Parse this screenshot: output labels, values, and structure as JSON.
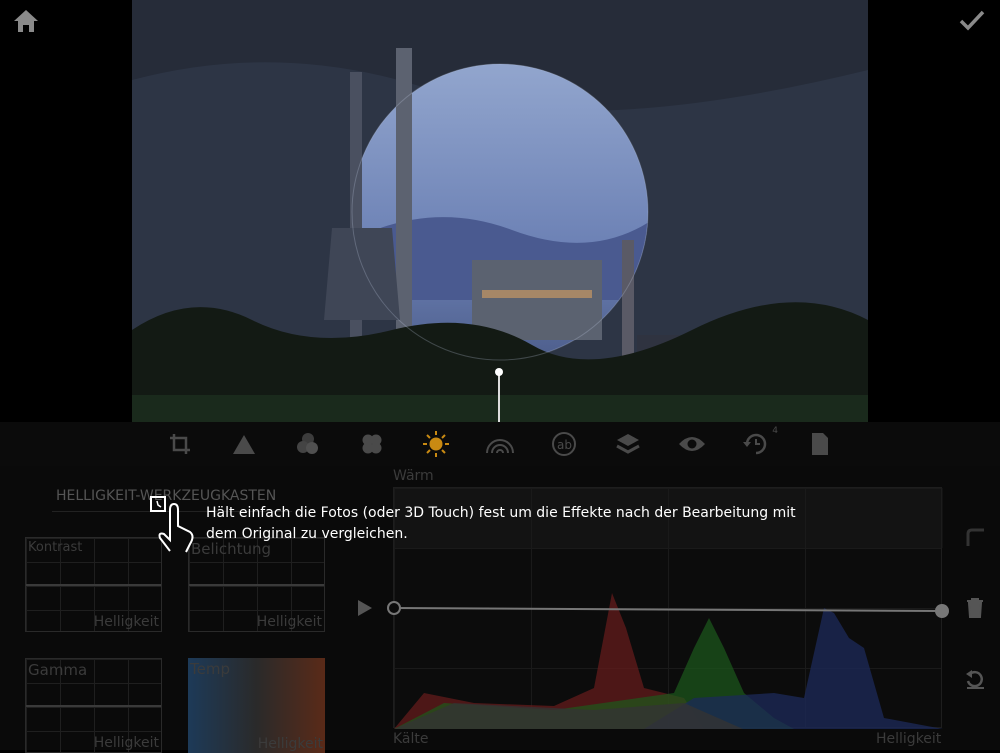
{
  "top": {
    "home_icon": "home-icon",
    "done_icon": "checkmark-icon"
  },
  "toolbar": {
    "items": [
      "crop-icon",
      "triangle-icon",
      "color-circles-icon",
      "clover-icon",
      "brightness-sun-icon",
      "rainbow-icon",
      "ab-icon",
      "layers-icon",
      "eye-icon",
      "history-icon",
      "document-icon"
    ],
    "history_count": "4",
    "active_color": "#c98a12"
  },
  "panel": {
    "title": "HELLIGKEIT-WERKZEUGKASTEN",
    "tiles": [
      {
        "label": "Kontrast",
        "sub": "Helligkeit"
      },
      {
        "label": "Belichtung",
        "sub": "Helligkeit"
      },
      {
        "label": "Gamma",
        "sub": "Helligkeit"
      },
      {
        "label": "Temp",
        "sub": "Helligkeit"
      }
    ],
    "curve": {
      "top_label": "Wärm",
      "bottom_left": "Kälte",
      "bottom_right": "Helligkeit"
    }
  },
  "tooltip": {
    "text": "Hält einfach die Fotos (oder 3D Touch) fest um die Effekte nach der Bearbeitung mit dem Original zu vergleichen."
  }
}
